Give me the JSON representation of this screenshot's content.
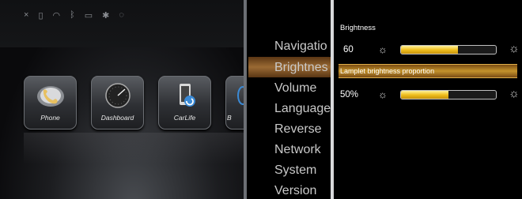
{
  "home": {
    "status_icons": [
      "close-icon",
      "signal-icon",
      "wifi-icon",
      "bluetooth-icon",
      "sdcard-icon",
      "usb-icon",
      "nosignal-icon"
    ],
    "apps": [
      {
        "label": "Phone",
        "icon": "phone-icon"
      },
      {
        "label": "Dashboard",
        "icon": "gauge-icon"
      },
      {
        "label": "CarLife",
        "icon": "carlife-icon"
      },
      {
        "label": "B",
        "icon": "browser-icon"
      }
    ]
  },
  "menu": {
    "items": [
      "Navigatio",
      "Brightnes",
      "Volume",
      "Language",
      "Reverse",
      "Network",
      "System",
      "Version"
    ],
    "selected_index": 1
  },
  "panel": {
    "title": "Brightness",
    "brightness_value": "60",
    "brightness_fraction": 0.6,
    "lamplet_label": "Lamplet brightness proportion",
    "lamplet_value": "50%",
    "lamplet_fraction": 0.5
  },
  "colors": {
    "accent": "#c4932c",
    "fill": "#f0c020"
  }
}
